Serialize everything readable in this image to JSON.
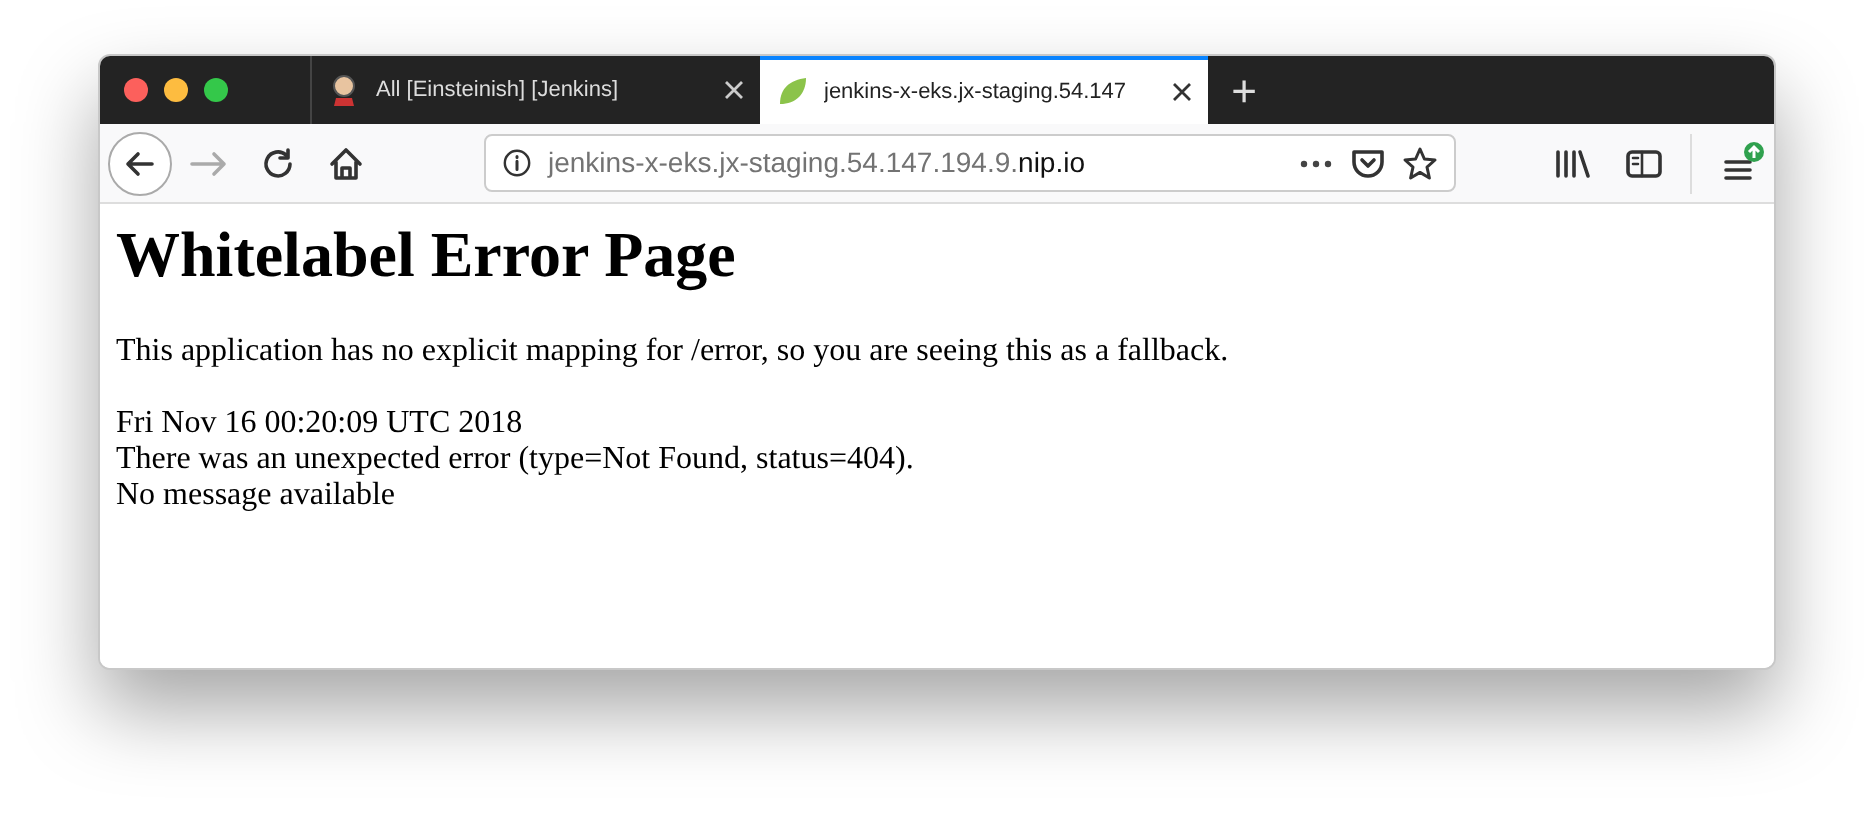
{
  "tabs": [
    {
      "title": "All [Einsteinish] [Jenkins]",
      "selected": false,
      "kind": "jenkins"
    },
    {
      "title": "jenkins-x-eks.jx-staging.54.147",
      "selected": true,
      "kind": "leaf"
    }
  ],
  "new_tab": "+",
  "address_bar": {
    "url_dim": "jenkins-x-eks.jx-staging.54.147.194.9.",
    "url_domain": "nip.io"
  },
  "page": {
    "heading": "Whitelabel Error Page",
    "paragraph": "This application has no explicit mapping for /error, so you are seeing this as a fallback.",
    "lines": [
      "Fri Nov 16 00:20:09 UTC 2018",
      "There was an unexpected error (type=Not Found, status=404).",
      "No message available"
    ]
  }
}
